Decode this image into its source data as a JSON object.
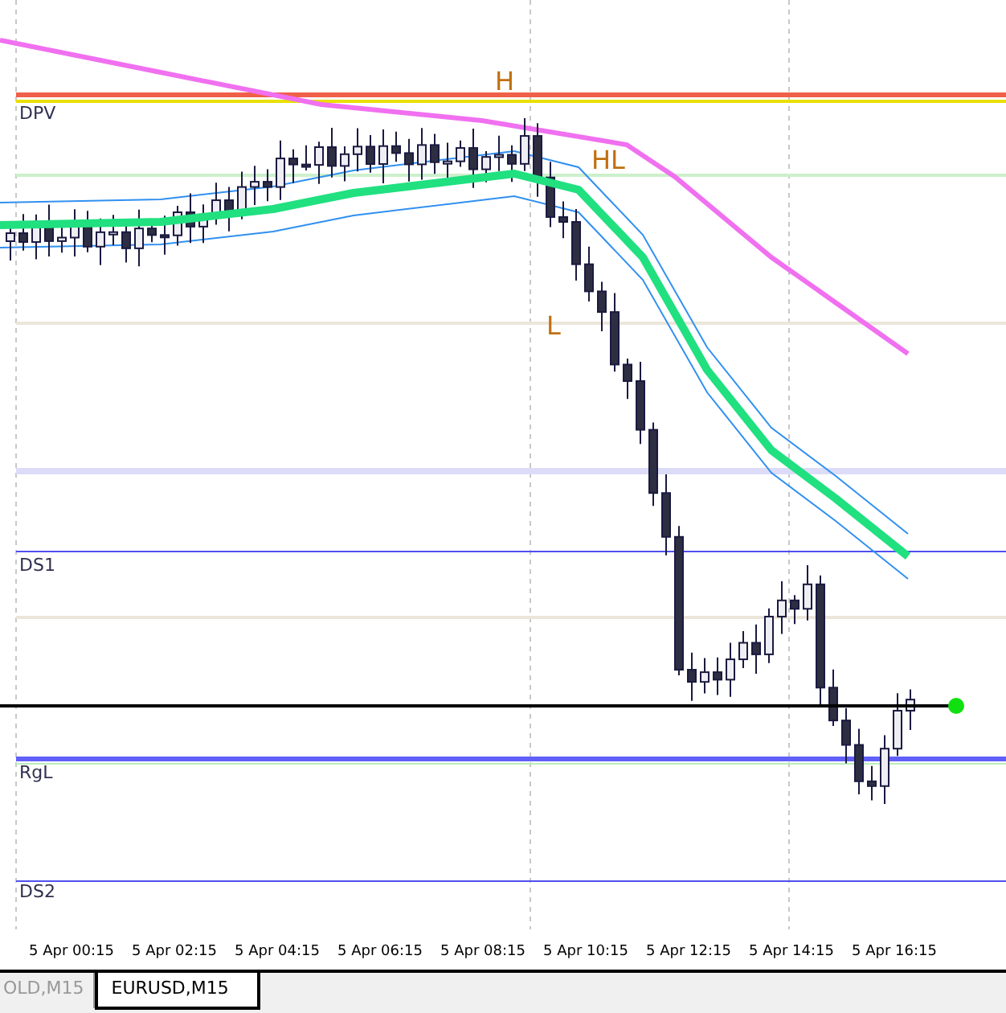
{
  "chart": {
    "labels": [
      {
        "text": "DPV",
        "kind": "level"
      },
      {
        "text": "H",
        "kind": "pivot"
      },
      {
        "text": "HL",
        "kind": "pivot"
      },
      {
        "text": "L",
        "kind": "pivot"
      },
      {
        "text": "DS1",
        "kind": "level"
      },
      {
        "text": "RgL",
        "kind": "level"
      },
      {
        "text": "DS2",
        "kind": "level"
      }
    ]
  },
  "time_axis": {
    "labels": [
      "5 Apr 00:15",
      "5 Apr 02:15",
      "5 Apr 04:15",
      "5 Apr 06:15",
      "5 Apr 08:15",
      "5 Apr 10:15",
      "5 Apr 12:15",
      "5 Apr 14:15",
      "5 Apr 16:15"
    ]
  },
  "tabs": [
    {
      "label": "OLD,M15",
      "selected": false
    },
    {
      "label": "EURUSD,M15",
      "selected": true
    }
  ]
}
